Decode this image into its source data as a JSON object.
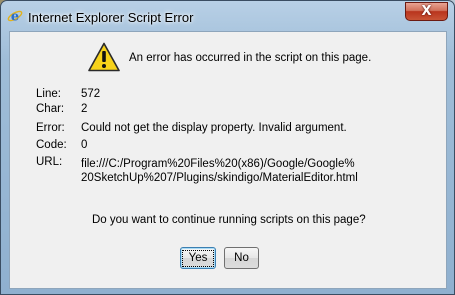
{
  "window": {
    "title": "Internet Explorer Script Error",
    "close_symbol": "X",
    "app_icon": "internet-explorer-icon"
  },
  "message": {
    "icon": "warning-icon",
    "text": "An error has occurred in the script on this page."
  },
  "details": {
    "line_label": "Line:",
    "line_value": "572",
    "char_label": "Char:",
    "char_value": "2",
    "error_label": "Error:",
    "error_value": "Could not get the display property. Invalid argument.",
    "code_label": "Code:",
    "code_value": "0",
    "url_label": "URL:",
    "url_value_line1": "file:///C:/Program%20Files%20(x86)/Google/Google%",
    "url_value_line2": "20SketchUp%207/Plugins/skindigo/MaterialEditor.html"
  },
  "question": "Do you want to continue running scripts on this page?",
  "buttons": {
    "yes_label": "Yes",
    "no_label": "No"
  },
  "colors": {
    "titlebar": "#9fbdd8",
    "close_button": "#c85436",
    "client_background": "#f0f0f0",
    "warning_yellow": "#f6d21a"
  }
}
